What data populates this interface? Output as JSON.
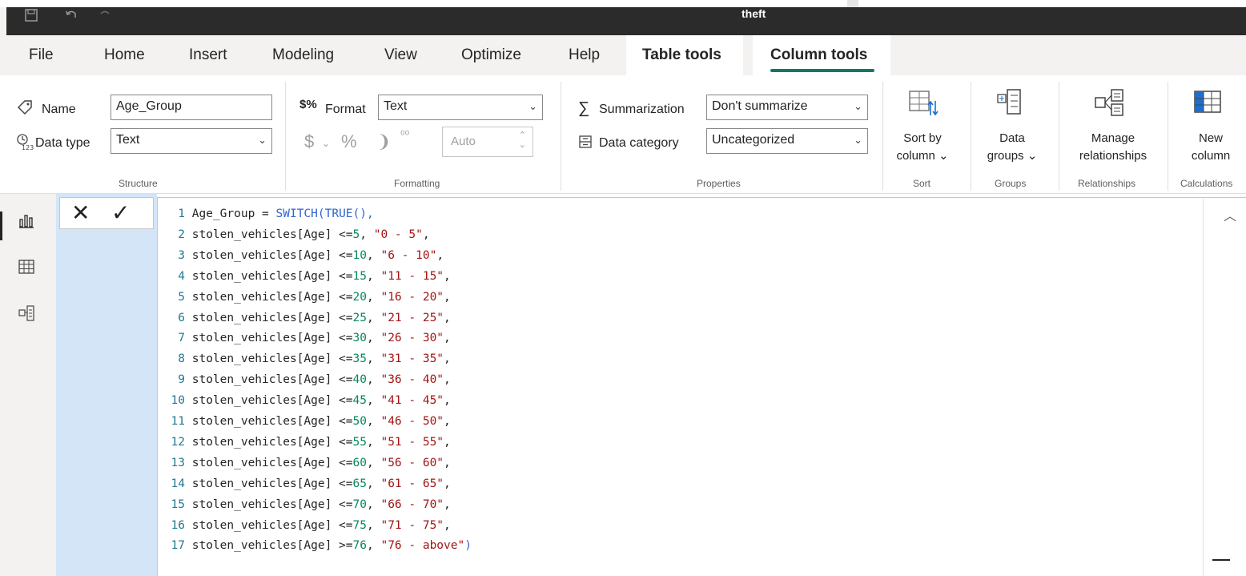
{
  "window": {
    "title": "theft",
    "icons": [
      "save-icon",
      "undo-icon",
      "redo-icon"
    ]
  },
  "menu": {
    "file": "File",
    "home": "Home",
    "insert": "Insert",
    "modeling": "Modeling",
    "view": "View",
    "optimize": "Optimize",
    "help": "Help",
    "table_tools": "Table tools",
    "column_tools": "Column tools"
  },
  "ribbon": {
    "structure": {
      "name_label": "Name",
      "name_value": "Age_Group",
      "datatype_label": "Data type",
      "datatype_value": "Text",
      "group_label": "Structure"
    },
    "formatting": {
      "format_label": "Format",
      "format_value": "Text",
      "currency_symbol": "$",
      "percent_symbol": "%",
      "comma_symbol": "❩",
      "decimal_symbol": "⁰⁰",
      "auto_value": "Auto",
      "group_label": "Formatting"
    },
    "properties": {
      "summarization_label": "Summarization",
      "summarization_value": "Don't summarize",
      "category_label": "Data category",
      "category_value": "Uncategorized",
      "group_label": "Properties"
    },
    "sort": {
      "line1": "Sort by",
      "line2": "column ⌄",
      "group_label": "Sort"
    },
    "groups": {
      "line1": "Data",
      "line2": "groups ⌄",
      "group_label": "Groups"
    },
    "relationships": {
      "line1": "Manage",
      "line2": "relationships",
      "group_label": "Relationships"
    },
    "calculations": {
      "line1": "New",
      "line2": "column",
      "group_label": "Calculations"
    },
    "accent_color": "#117865"
  },
  "formula_bar": {
    "cancel_glyph": "✕",
    "commit_glyph": "✓",
    "lines": [
      {
        "n": "1",
        "a": "Age_Group = ",
        "f": "SWITCH(TRUE(),",
        "num": "",
        "s": "",
        "e": ""
      },
      {
        "n": "2",
        "a": "stolen_vehicles[Age] <=",
        "f": "",
        "num": "5",
        "s": "\"0 - 5\"",
        "e": ","
      },
      {
        "n": "3",
        "a": "stolen_vehicles[Age] <=",
        "f": "",
        "num": "10",
        "s": "\"6 - 10\"",
        "e": ","
      },
      {
        "n": "4",
        "a": "stolen_vehicles[Age] <=",
        "f": "",
        "num": "15",
        "s": "\"11 - 15\"",
        "e": ","
      },
      {
        "n": "5",
        "a": "stolen_vehicles[Age] <=",
        "f": "",
        "num": "20",
        "s": "\"16 - 20\"",
        "e": ","
      },
      {
        "n": "6",
        "a": "stolen_vehicles[Age] <=",
        "f": "",
        "num": "25",
        "s": "\"21 - 25\"",
        "e": ","
      },
      {
        "n": "7",
        "a": "stolen_vehicles[Age] <=",
        "f": "",
        "num": "30",
        "s": "\"26 - 30\"",
        "e": ","
      },
      {
        "n": "8",
        "a": "stolen_vehicles[Age] <=",
        "f": "",
        "num": "35",
        "s": "\"31 - 35\"",
        "e": ","
      },
      {
        "n": "9",
        "a": "stolen_vehicles[Age] <=",
        "f": "",
        "num": "40",
        "s": "\"36 - 40\"",
        "e": ","
      },
      {
        "n": "10",
        "a": "stolen_vehicles[Age] <=",
        "f": "",
        "num": "45",
        "s": "\"41 - 45\"",
        "e": ","
      },
      {
        "n": "11",
        "a": "stolen_vehicles[Age] <=",
        "f": "",
        "num": "50",
        "s": "\"46 - 50\"",
        "e": ","
      },
      {
        "n": "12",
        "a": "stolen_vehicles[Age] <=",
        "f": "",
        "num": "55",
        "s": "\"51 - 55\"",
        "e": ","
      },
      {
        "n": "13",
        "a": "stolen_vehicles[Age] <=",
        "f": "",
        "num": "60",
        "s": "\"56 - 60\"",
        "e": ","
      },
      {
        "n": "14",
        "a": "stolen_vehicles[Age] <=",
        "f": "",
        "num": "65",
        "s": "\"61 - 65\"",
        "e": ","
      },
      {
        "n": "15",
        "a": "stolen_vehicles[Age] <=",
        "f": "",
        "num": "70",
        "s": "\"66 - 70\"",
        "e": ","
      },
      {
        "n": "16",
        "a": "stolen_vehicles[Age] <=",
        "f": "",
        "num": "75",
        "s": "\"71 - 75\"",
        "e": ","
      },
      {
        "n": "17",
        "a": "stolen_vehicles[Age] >=",
        "f": "",
        "num": "76",
        "s": "\"76 - above\"",
        "e": ")"
      }
    ]
  },
  "left_rail": {
    "items": [
      "report-view-icon",
      "table-view-icon",
      "model-view-icon"
    ]
  }
}
